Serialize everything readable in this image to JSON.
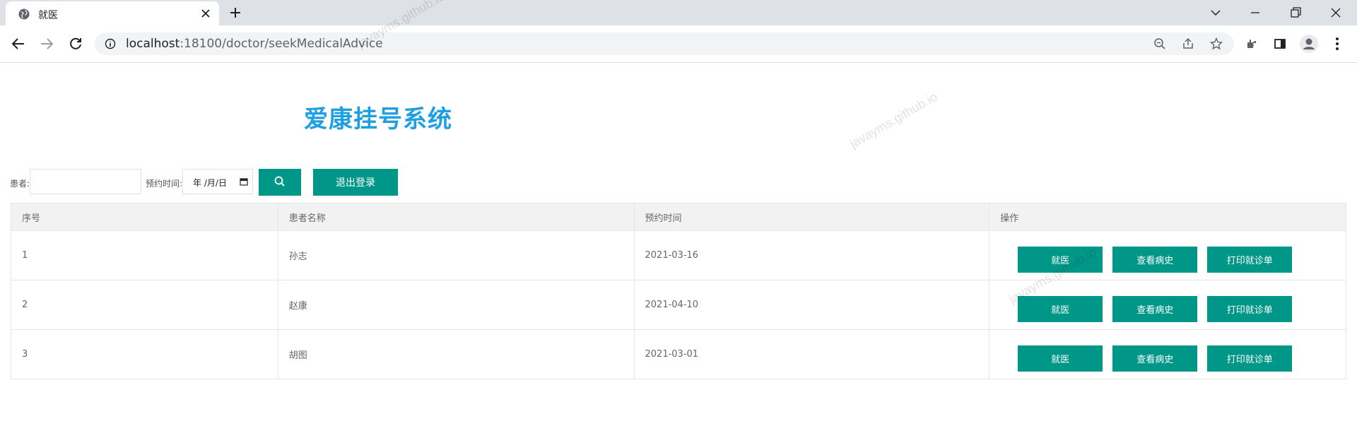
{
  "browser": {
    "tab_title": "就医",
    "url_host": "localhost",
    "url_path": ":18100/doctor/seekMedicalAdvice"
  },
  "page": {
    "brand_title": "爱康挂号系统",
    "search": {
      "patient_label": "患者:",
      "patient_value": "",
      "time_label": "预约时间:",
      "date_placeholder": "年 /月/日",
      "logout_label": "退出登录"
    },
    "table": {
      "headers": [
        "序号",
        "患者名称",
        "预约时间",
        "操作"
      ],
      "rows": [
        {
          "no": "1",
          "name": "孙志",
          "time": "2021-03-16"
        },
        {
          "no": "2",
          "name": "赵康",
          "time": "2021-04-10"
        },
        {
          "no": "3",
          "name": "胡图",
          "time": "2021-03-01"
        }
      ],
      "actions": {
        "treat": "就医",
        "history": "查看病史",
        "print": "打印就诊单"
      }
    },
    "watermark": "javayms.github.io"
  },
  "colors": {
    "accent": "#009688",
    "brand": "#1e9fe0"
  }
}
